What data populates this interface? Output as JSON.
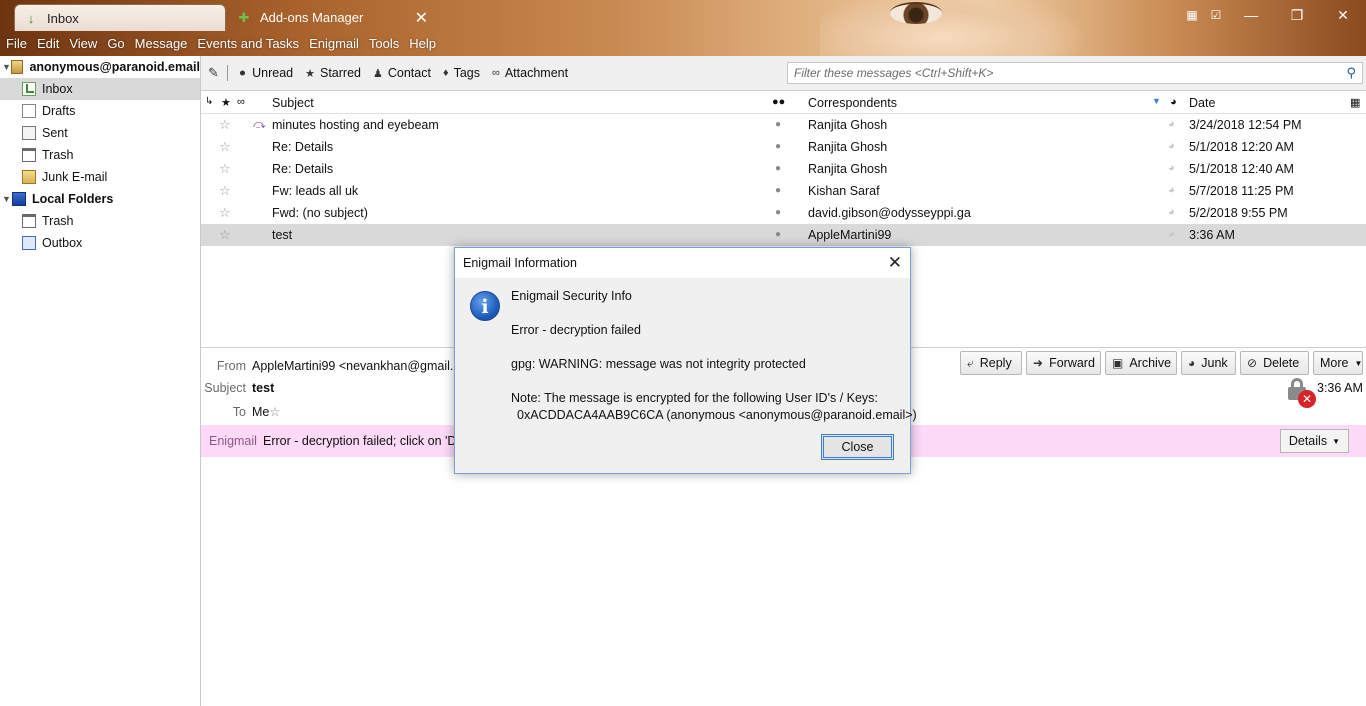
{
  "window": {
    "tabs": [
      {
        "label": "Inbox"
      },
      {
        "label": "Add-ons Manager"
      }
    ]
  },
  "menu": [
    "File",
    "Edit",
    "View",
    "Go",
    "Message",
    "Events and Tasks",
    "Enigmail",
    "Tools",
    "Help"
  ],
  "folders": {
    "account": "anonymous@paranoid.email",
    "account_folders": [
      "Inbox",
      "Drafts",
      "Sent",
      "Trash",
      "Junk E-mail"
    ],
    "local": "Local Folders",
    "local_folders": [
      "Trash",
      "Outbox"
    ]
  },
  "quickfilter": {
    "buttons": [
      "Unread",
      "Starred",
      "Contact",
      "Tags",
      "Attachment"
    ],
    "placeholder": "Filter these messages <Ctrl+Shift+K>"
  },
  "columns": {
    "subject": "Subject",
    "correspondents": "Correspondents",
    "date": "Date"
  },
  "messages": [
    {
      "subject": "minutes hosting and eyebeam",
      "correspondent": "Ranjita Ghosh",
      "date": "3/24/2018 12:54 PM",
      "replied": true
    },
    {
      "subject": "Re: Details",
      "correspondent": "Ranjita Ghosh",
      "date": "5/1/2018 12:20 AM"
    },
    {
      "subject": "Re: Details",
      "correspondent": "Ranjita Ghosh",
      "date": "5/1/2018 12:40 AM"
    },
    {
      "subject": "Fw: leads all uk",
      "correspondent": "Kishan Saraf",
      "date": "5/7/2018 11:25 PM"
    },
    {
      "subject": "Fwd: (no subject)",
      "correspondent": "david.gibson@odysseyppi.ga",
      "date": "5/2/2018 9:55 PM"
    },
    {
      "subject": "test",
      "correspondent": "AppleMartini99",
      "date": "3:36 AM",
      "selected": true
    }
  ],
  "header": {
    "from_label": "From",
    "from": "AppleMartini99 <nevankhan@gmail.c",
    "subject_label": "Subject",
    "subject": "test",
    "to_label": "To",
    "to": "Me",
    "time": "3:36 AM",
    "buttons": [
      "Reply",
      "Forward",
      "Archive",
      "Junk",
      "Delete",
      "More"
    ]
  },
  "enigmail_bar": {
    "label": "Enigmail",
    "message": "Error - decryption failed; click on 'De",
    "details": "Details"
  },
  "dialog": {
    "title": "Enigmail Information",
    "heading": "Enigmail Security Info",
    "error": "Error - decryption failed",
    "warning": "gpg: WARNING: message was not integrity protected",
    "note": "Note: The message is encrypted for the following User ID's / Keys:",
    "key": "0xACDDACA4AAB9C6CA (anonymous <anonymous@paranoid.email>)",
    "close": "Close"
  },
  "colors": {
    "enigmail_bar": "#fbd9f7",
    "selection": "#d9d9d9",
    "dialog_border": "#7a9fd3"
  }
}
